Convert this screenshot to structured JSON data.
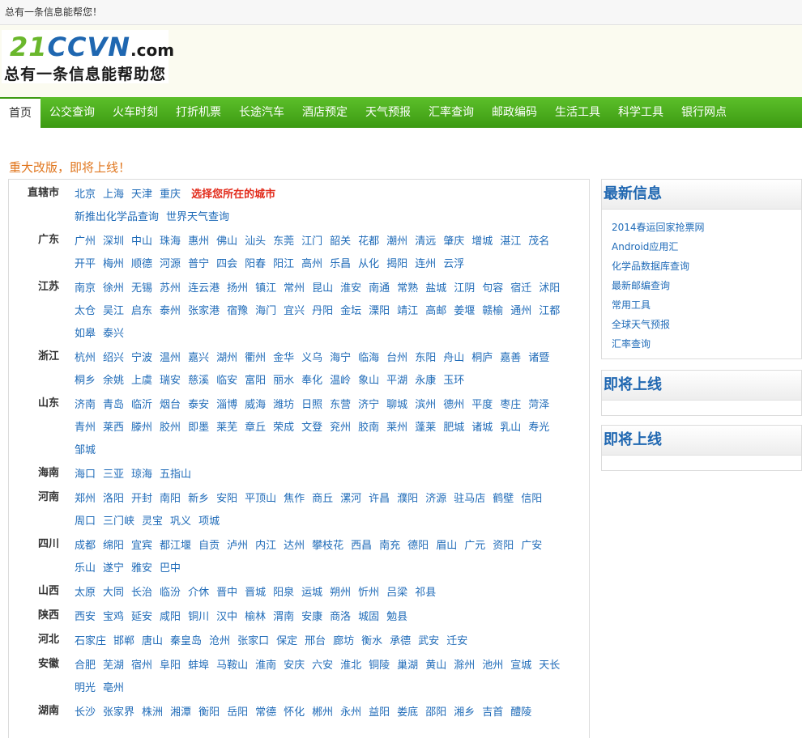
{
  "topbar": {
    "text": "总有一条信息能帮您！"
  },
  "logo": {
    "part1": "21",
    "part2": "CCVN",
    "part3": ".com",
    "slogan": "总有一条信息能帮助您"
  },
  "nav": [
    {
      "label": "首页",
      "active": true
    },
    {
      "label": "公交查询"
    },
    {
      "label": "火车时刻"
    },
    {
      "label": "打折机票"
    },
    {
      "label": "长途汽车"
    },
    {
      "label": "酒店预定"
    },
    {
      "label": "天气预报"
    },
    {
      "label": "汇率查询"
    },
    {
      "label": "邮政编码"
    },
    {
      "label": "生活工具"
    },
    {
      "label": "科学工具"
    },
    {
      "label": "银行网点"
    }
  ],
  "notice": "重大改版，即将上线！",
  "regions": [
    {
      "name": "直辖市",
      "rows": [
        [
          "北京",
          "上海",
          "天津",
          "重庆"
        ],
        [
          "新推出化学品查询",
          "世界天气查询"
        ]
      ],
      "highlight": "选择您所在的城市"
    },
    {
      "name": "广东",
      "rows": [
        [
          "广州",
          "深圳",
          "中山",
          "珠海",
          "惠州",
          "佛山",
          "汕头",
          "东莞",
          "江门",
          "韶关",
          "花都",
          "潮州",
          "清远",
          "肇庆",
          "增城",
          "湛江",
          "茂名"
        ],
        [
          "开平",
          "梅州",
          "顺德",
          "河源",
          "普宁",
          "四会",
          "阳春",
          "阳江",
          "高州",
          "乐昌",
          "从化",
          "揭阳",
          "连州",
          "云浮"
        ]
      ]
    },
    {
      "name": "江苏",
      "rows": [
        [
          "南京",
          "徐州",
          "无锡",
          "苏州",
          "连云港",
          "扬州",
          "镇江",
          "常州",
          "昆山",
          "淮安",
          "南通",
          "常熟",
          "盐城",
          "江阴",
          "句容",
          "宿迁",
          "沭阳"
        ],
        [
          "太仓",
          "吴江",
          "启东",
          "泰州",
          "张家港",
          "宿豫",
          "海门",
          "宜兴",
          "丹阳",
          "金坛",
          "溧阳",
          "靖江",
          "高邮",
          "姜堰",
          "赣榆",
          "通州",
          "江都"
        ],
        [
          "如皋",
          "泰兴"
        ]
      ]
    },
    {
      "name": "浙江",
      "rows": [
        [
          "杭州",
          "绍兴",
          "宁波",
          "温州",
          "嘉兴",
          "湖州",
          "衢州",
          "金华",
          "义乌",
          "海宁",
          "临海",
          "台州",
          "东阳",
          "舟山",
          "桐庐",
          "嘉善",
          "诸暨"
        ],
        [
          "桐乡",
          "余姚",
          "上虞",
          "瑞安",
          "慈溪",
          "临安",
          "富阳",
          "丽水",
          "奉化",
          "温岭",
          "象山",
          "平湖",
          "永康",
          "玉环"
        ]
      ]
    },
    {
      "name": "山东",
      "rows": [
        [
          "济南",
          "青岛",
          "临沂",
          "烟台",
          "泰安",
          "淄博",
          "威海",
          "潍坊",
          "日照",
          "东营",
          "济宁",
          "聊城",
          "滨州",
          "德州",
          "平度",
          "枣庄",
          "菏泽"
        ],
        [
          "青州",
          "莱西",
          "滕州",
          "胶州",
          "即墨",
          "莱芜",
          "章丘",
          "荣成",
          "文登",
          "兖州",
          "胶南",
          "莱州",
          "蓬莱",
          "肥城",
          "诸城",
          "乳山",
          "寿光"
        ],
        [
          "邹城"
        ]
      ]
    },
    {
      "name": "海南",
      "rows": [
        [
          "海口",
          "三亚",
          "琼海",
          "五指山"
        ]
      ]
    },
    {
      "name": "河南",
      "rows": [
        [
          "郑州",
          "洛阳",
          "开封",
          "南阳",
          "新乡",
          "安阳",
          "平顶山",
          "焦作",
          "商丘",
          "漯河",
          "许昌",
          "濮阳",
          "济源",
          "驻马店",
          "鹤壁",
          "信阳"
        ],
        [
          "周口",
          "三门峡",
          "灵宝",
          "巩义",
          "项城"
        ]
      ]
    },
    {
      "name": "四川",
      "rows": [
        [
          "成都",
          "绵阳",
          "宜宾",
          "都江堰",
          "自贡",
          "泸州",
          "内江",
          "达州",
          "攀枝花",
          "西昌",
          "南充",
          "德阳",
          "眉山",
          "广元",
          "资阳",
          "广安"
        ],
        [
          "乐山",
          "遂宁",
          "雅安",
          "巴中"
        ]
      ]
    },
    {
      "name": "山西",
      "rows": [
        [
          "太原",
          "大同",
          "长治",
          "临汾",
          "介休",
          "晋中",
          "晋城",
          "阳泉",
          "运城",
          "朔州",
          "忻州",
          "吕梁",
          "祁县"
        ]
      ]
    },
    {
      "name": "陕西",
      "rows": [
        [
          "西安",
          "宝鸡",
          "延安",
          "咸阳",
          "铜川",
          "汉中",
          "榆林",
          "渭南",
          "安康",
          "商洛",
          "城固",
          "勉县"
        ]
      ]
    },
    {
      "name": "河北",
      "rows": [
        [
          "石家庄",
          "邯郸",
          "唐山",
          "秦皇岛",
          "沧州",
          "张家口",
          "保定",
          "邢台",
          "廊坊",
          "衡水",
          "承德",
          "武安",
          "迁安"
        ]
      ]
    },
    {
      "name": "安徽",
      "rows": [
        [
          "合肥",
          "芜湖",
          "宿州",
          "阜阳",
          "蚌埠",
          "马鞍山",
          "淮南",
          "安庆",
          "六安",
          "淮北",
          "铜陵",
          "巢湖",
          "黄山",
          "滁州",
          "池州",
          "宣城",
          "天长"
        ],
        [
          "明光",
          "亳州"
        ]
      ]
    },
    {
      "name": "湖南",
      "rows": [
        [
          "长沙",
          "张家界",
          "株洲",
          "湘潭",
          "衡阳",
          "岳阳",
          "常德",
          "怀化",
          "郴州",
          "永州",
          "益阳",
          "娄底",
          "邵阳",
          "湘乡",
          "吉首",
          "醴陵"
        ]
      ]
    }
  ],
  "sidebar": [
    {
      "title": "最新信息",
      "items": [
        "2014春运回家抢票网",
        "Android应用汇",
        "化学品数据库查询",
        "最新邮编查询",
        "常用工具",
        "全球天气预报",
        "汇率查询"
      ]
    },
    {
      "title": "即将上线",
      "items": []
    },
    {
      "title": "即将上线",
      "items": []
    }
  ]
}
